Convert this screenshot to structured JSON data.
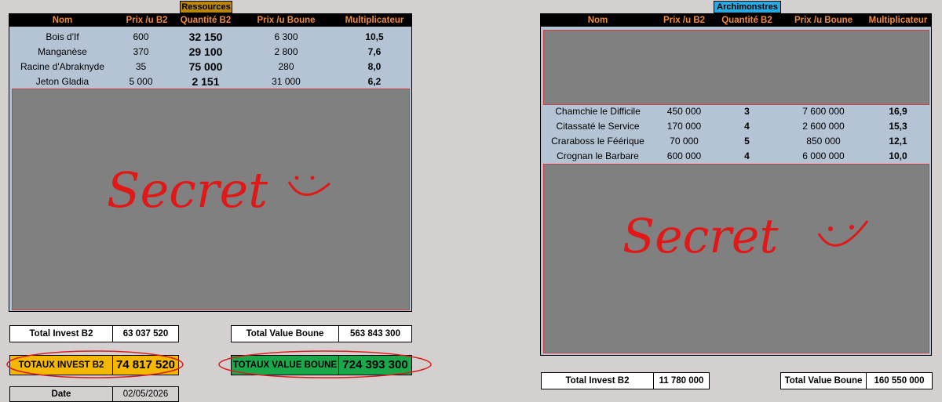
{
  "ressources": {
    "tag": "Ressources",
    "headers": [
      "Nom",
      "Prix /u B2",
      "Quantité B2",
      "Prix /u Boune",
      "Multiplicateur"
    ],
    "rows": [
      {
        "nom": "Bois d'If",
        "prix_b2": "600",
        "qte": "32 150",
        "prix_boune": "6 300",
        "mult": "10,5"
      },
      {
        "nom": "Manganèse",
        "prix_b2": "370",
        "qte": "29 100",
        "prix_boune": "2 800",
        "mult": "7,6"
      },
      {
        "nom": "Racine d'Abraknyde",
        "prix_b2": "35",
        "qte": "75 000",
        "prix_boune": "280",
        "mult": "8,0"
      },
      {
        "nom": "Jeton Gladia",
        "prix_b2": "5 000",
        "qte": "2 151",
        "prix_boune": "31 000",
        "mult": "6,2"
      }
    ],
    "secret_text": "Secret",
    "total_invest_label": "Total Invest B2",
    "total_invest_value": "63 037 520",
    "total_value_label": "Total Value Boune",
    "total_value_value": "563 843 300"
  },
  "totaux": {
    "invest_label": "TOTAUX INVEST B2",
    "invest_value": "74 817 520",
    "value_label": "TOTAUX VALUE BOUNE",
    "value_value": "724 393 300",
    "date_label": "Date",
    "date_value": "02/05/2026"
  },
  "archimonstres": {
    "tag": "Archimonstres",
    "headers": [
      "Nom",
      "Prix /u B2",
      "Quantité B2",
      "Prix /u Boune",
      "Multiplicateur"
    ],
    "rows": [
      {
        "nom": "Chamchie le Difficile",
        "prix_b2": "450 000",
        "qte": "3",
        "prix_boune": "7 600 000",
        "mult": "16,9"
      },
      {
        "nom": "Citassaté le Service",
        "prix_b2": "170 000",
        "qte": "4",
        "prix_boune": "2 600 000",
        "mult": "15,3"
      },
      {
        "nom": "Craraboss le Féérique",
        "prix_b2": "70 000",
        "qte": "5",
        "prix_boune": "850 000",
        "mult": "12,1"
      },
      {
        "nom": "Crognan le Barbare",
        "prix_b2": "600 000",
        "qte": "4",
        "prix_boune": "6 000 000",
        "mult": "10,0"
      }
    ],
    "secret_text": "Secret",
    "total_invest_label": "Total Invest B2",
    "total_invest_value": "11 780 000",
    "total_value_label": "Total Value Boune",
    "total_value_value": "160 550 000"
  },
  "colors": {
    "header_text": "#f08b3c",
    "table_bg": "#b4c4d4",
    "secret_bg": "#808080",
    "secret_ink": "#e01818",
    "ressources_tag": "#b8860b",
    "archimonstres_tag": "#29a9e0",
    "invest_highlight": "#f5b800",
    "value_highlight": "#1aa84a"
  }
}
